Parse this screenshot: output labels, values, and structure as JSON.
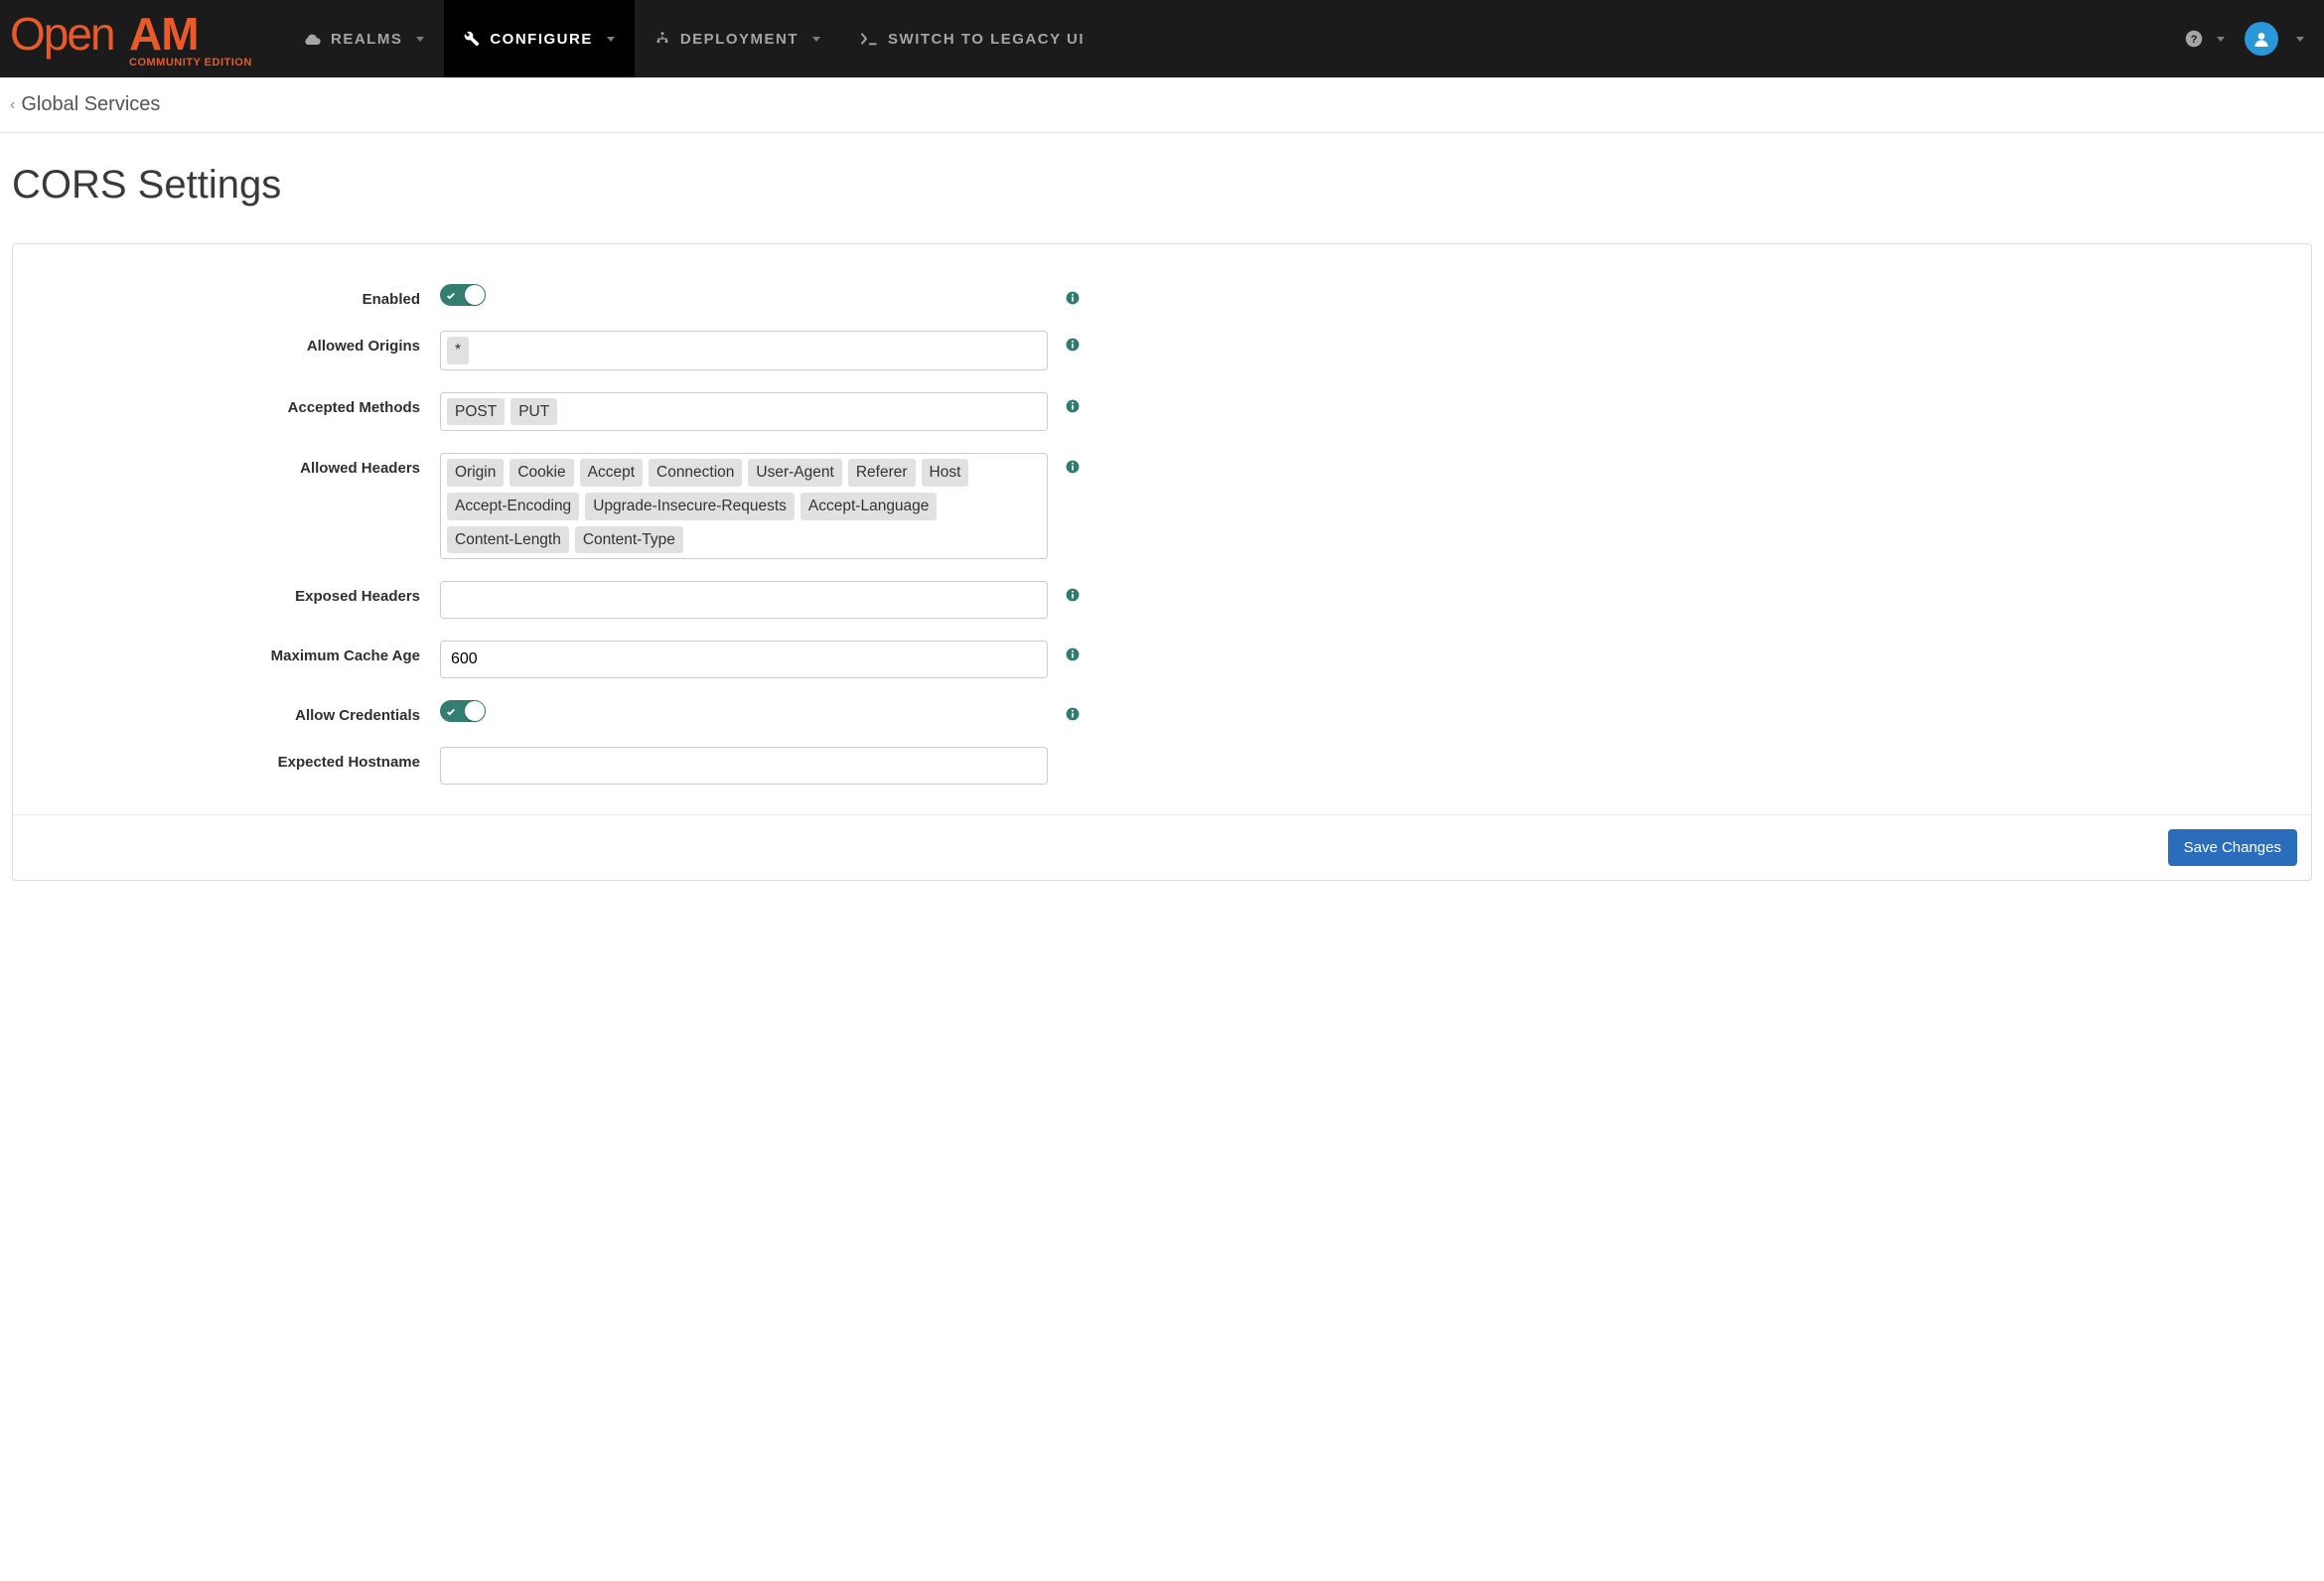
{
  "logo": {
    "main": "OpenAM",
    "sub": "COMMUNITY EDITION"
  },
  "nav": {
    "realms": "REALMS",
    "configure": "CONFIGURE",
    "deployment": "DEPLOYMENT",
    "legacy": "SWITCH TO LEGACY UI"
  },
  "breadcrumb": {
    "back": "Global Services"
  },
  "page": {
    "title": "CORS Settings"
  },
  "form": {
    "labels": {
      "enabled": "Enabled",
      "allowedOrigins": "Allowed Origins",
      "acceptedMethods": "Accepted Methods",
      "allowedHeaders": "Allowed Headers",
      "exposedHeaders": "Exposed Headers",
      "maxCacheAge": "Maximum Cache Age",
      "allowCredentials": "Allow Credentials",
      "expectedHostname": "Expected Hostname"
    },
    "values": {
      "enabled": true,
      "allowedOrigins": [
        "*"
      ],
      "acceptedMethods": [
        "POST",
        "PUT"
      ],
      "allowedHeaders": [
        "Origin",
        "Cookie",
        "Accept",
        "Connection",
        "User-Agent",
        "Referer",
        "Host",
        "Accept-Encoding",
        "Upgrade-Insecure-Requests",
        "Accept-Language",
        "Content-Length",
        "Content-Type"
      ],
      "exposedHeaders": [],
      "maxCacheAge": "600",
      "allowCredentials": true,
      "expectedHostname": ""
    }
  },
  "footer": {
    "save": "Save Changes"
  }
}
